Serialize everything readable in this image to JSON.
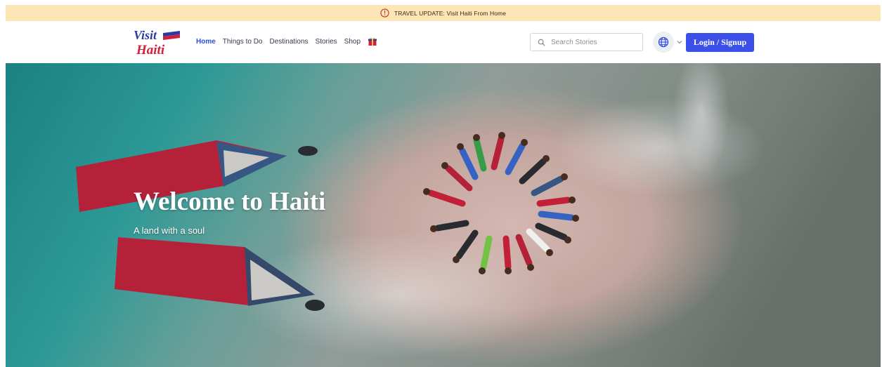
{
  "banner": {
    "text": "TRAVEL UPDATE: Visit Haiti From Home",
    "icon": "info-circle-icon",
    "color": "#fde6b5"
  },
  "logo": {
    "line1": "Visit",
    "line2": "Haiti"
  },
  "nav": {
    "items": [
      {
        "label": "Home",
        "active": true
      },
      {
        "label": "Things to Do"
      },
      {
        "label": "Destinations"
      },
      {
        "label": "Stories"
      },
      {
        "label": "Shop"
      }
    ],
    "shop_icon": "gift-box-icon",
    "active_color": "#2e4be0"
  },
  "search": {
    "placeholder": "Search Stories",
    "value": ""
  },
  "language": {
    "icon": "globe-icon"
  },
  "login": {
    "label": "Login / Signup",
    "color": "#3a50e8"
  },
  "hero": {
    "title": "Welcome to Haiti",
    "subtitle": "A land with a soul"
  }
}
